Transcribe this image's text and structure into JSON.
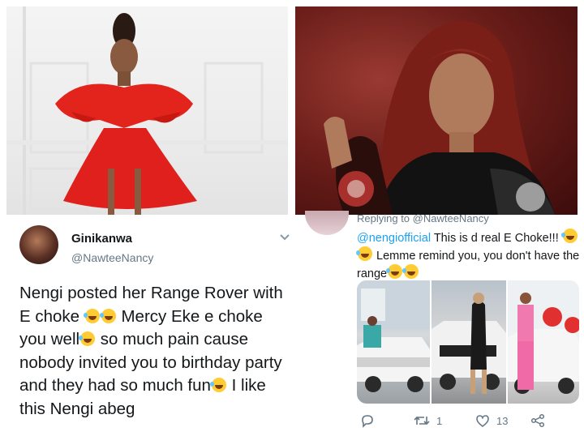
{
  "tweet_left": {
    "display_name": "Ginikanwa",
    "handle": "@NawteeNancy",
    "text_parts": {
      "p1": "Nengi posted her Range Rover with E choke ",
      "p2": " Mercy Eke e choke you well",
      "p3": " so much pain cause nobody invited you to birthday party and they had so much fun",
      "p4": " I like this Nengi abeg"
    }
  },
  "tweet_right": {
    "replying": "Replying to @NawteeNancy",
    "mention": "@nengiofficial",
    "text_parts": {
      "p1": " This is d real E Choke!!! ",
      "p2": " Lemme remind you, you don't have the range"
    },
    "actions": {
      "retweets": "1",
      "likes": "13"
    }
  },
  "colors": {
    "text": "#14171a",
    "secondary": "#657786",
    "link": "#1da1f2",
    "dress_red": "#e0201c"
  },
  "icons": [
    "chevron-down-icon",
    "reply-icon",
    "retweet-icon",
    "like-icon",
    "share-icon",
    "laughing-emoji-icon",
    "joy-emoji-icon"
  ]
}
